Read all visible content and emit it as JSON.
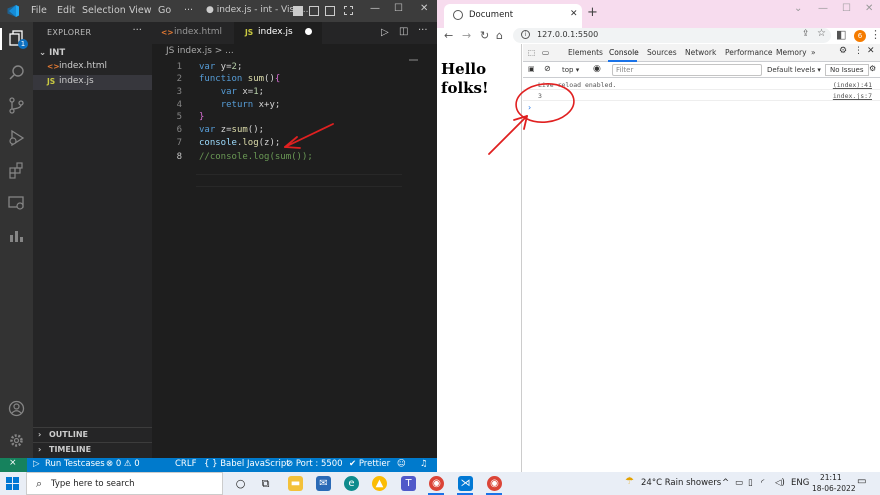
{
  "vscode": {
    "menu": [
      "File",
      "Edit",
      "Selection",
      "View",
      "Go",
      "···"
    ],
    "window_title": "● index.js - int - Visu...",
    "explorer": {
      "header": "EXPLORER",
      "folder": "INT",
      "files": [
        {
          "icon": "<>",
          "name": "index.html"
        },
        {
          "icon": "JS",
          "name": "index.js"
        }
      ],
      "outline": "OUTLINE",
      "timeline": "TIMELINE"
    },
    "tabs": [
      {
        "icon": "<>",
        "name": "index.html"
      },
      {
        "icon": "JS",
        "name": "index.js"
      }
    ],
    "breadcrumb": "JS  index.js > ...",
    "line_numbers": [
      "1",
      "2",
      "3",
      "4",
      "5",
      "6",
      "7",
      "8"
    ],
    "code_lines": [
      "var y=2;",
      "function sum(){",
      "    var x=1;",
      "    return x+y;",
      "}",
      "var z=sum();",
      "console.log(z);",
      "//console.log(sum());"
    ],
    "status": {
      "run_testcases": "Run Testcases",
      "problems": "⊗ 0 ⚠ 0",
      "eol": "CRLF",
      "language": "{ } Babel JavaScript",
      "port": "⊘ Port : 5500",
      "prettier": "✔ Prettier"
    },
    "colors": {
      "accent": "#007acc",
      "editor_bg": "#1e1e1e",
      "sidebar_bg": "#252526"
    }
  },
  "browser": {
    "tab_title": "Document",
    "address": "127.0.0.1:5500",
    "profile_initial": "6",
    "page_text": "Hello folks!",
    "devtools_tabs": [
      "Elements",
      "Console",
      "Sources",
      "Network",
      "Performance",
      "Memory",
      "»"
    ],
    "context": "top ▾",
    "filter_placeholder": "Filter",
    "levels": "Default levels ▾",
    "no_issues": "No Issues",
    "console": [
      {
        "msg": "Live reload enabled.",
        "src": "(index):41"
      },
      {
        "msg": "3",
        "src": "index.js:7"
      }
    ],
    "prompt": "›"
  },
  "taskbar": {
    "search_placeholder": "Type here to search",
    "weather": "24°C  Rain showers",
    "language": "ENG",
    "time": "21:11",
    "date": "18-06-2022"
  }
}
